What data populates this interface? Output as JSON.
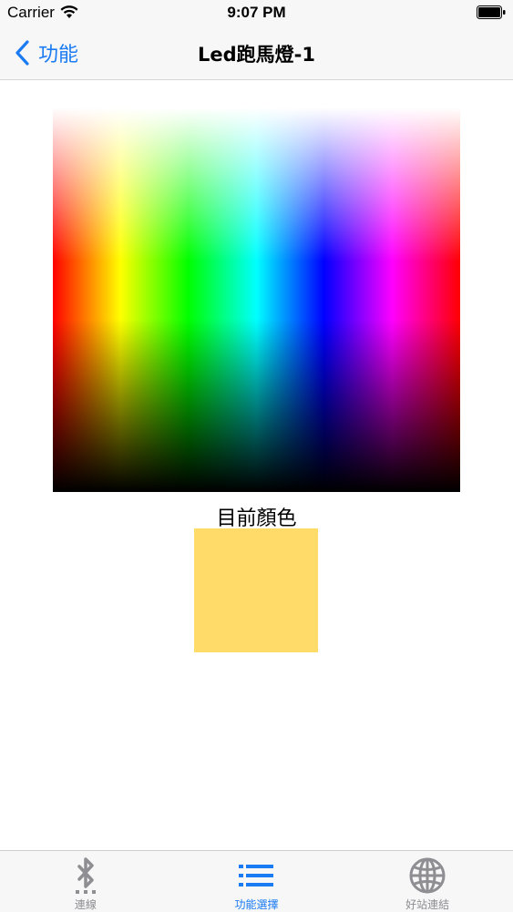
{
  "status_bar": {
    "carrier": "Carrier",
    "time": "9:07 PM"
  },
  "nav": {
    "back_label": "功能",
    "title": "Led跑馬燈-1"
  },
  "main": {
    "current_color_label": "目前顏色",
    "current_color": "#ffdc6a"
  },
  "tabs": [
    {
      "label": "連線",
      "icon": "bluetooth-icon",
      "active": false
    },
    {
      "label": "功能選擇",
      "icon": "list-icon",
      "active": true
    },
    {
      "label": "好站連結",
      "icon": "globe-icon",
      "active": false
    }
  ],
  "colors": {
    "accent": "#1a7bf2",
    "inactive": "#8e8e93",
    "bar_background": "#f7f7f7"
  }
}
